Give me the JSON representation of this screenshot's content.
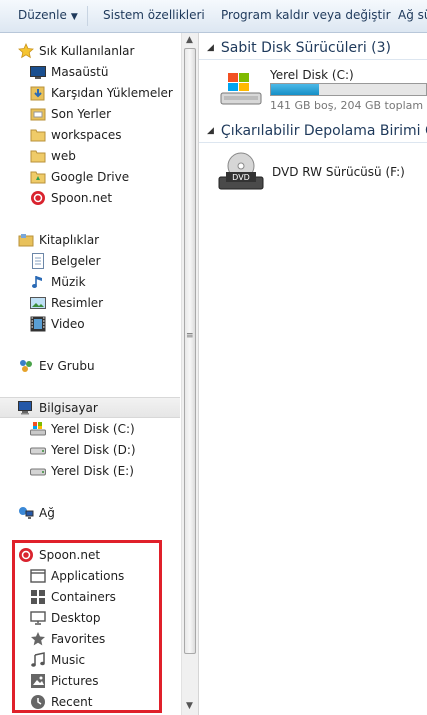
{
  "toolbar": {
    "organize": "Düzenle",
    "system_properties": "Sistem özellikleri",
    "uninstall": "Program kaldır veya değiştir",
    "network": "Ağ sü"
  },
  "nav": {
    "favorites": {
      "header": "Sık Kullanılanlar",
      "items": [
        "Masaüstü",
        "Karşıdan Yüklemeler",
        "Son Yerler",
        "workspaces",
        "web",
        "Google Drive",
        "Spoon.net"
      ]
    },
    "libraries": {
      "header": "Kitaplıklar",
      "items": [
        "Belgeler",
        "Müzik",
        "Resimler",
        "Video"
      ]
    },
    "homegroup": "Ev Grubu",
    "computer": {
      "header": "Bilgisayar",
      "items": [
        "Yerel Disk (C:)",
        "Yerel Disk (D:)",
        "Yerel Disk (E:)"
      ]
    },
    "network": "Ağ",
    "spoon": {
      "header": "Spoon.net",
      "items": [
        "Applications",
        "Containers",
        "Desktop",
        "Favorites",
        "Music",
        "Pictures",
        "Recent"
      ]
    }
  },
  "content": {
    "hdd_group": "Sabit Disk Sürücüleri (3)",
    "removable_group": "Çıkarılabilir Depolama Birimi Ola",
    "drive_c": {
      "name": "Yerel Disk (C:)",
      "free_text": "141 GB boş, 204 GB toplam",
      "used_fraction": 0.31
    },
    "dvd": {
      "name": "DVD RW Sürücüsü (F:)",
      "badge": "DVD"
    }
  },
  "colors": {
    "highlight": "#e0202a",
    "drive_bar": "#168fc6",
    "group_title": "#1e395b"
  }
}
